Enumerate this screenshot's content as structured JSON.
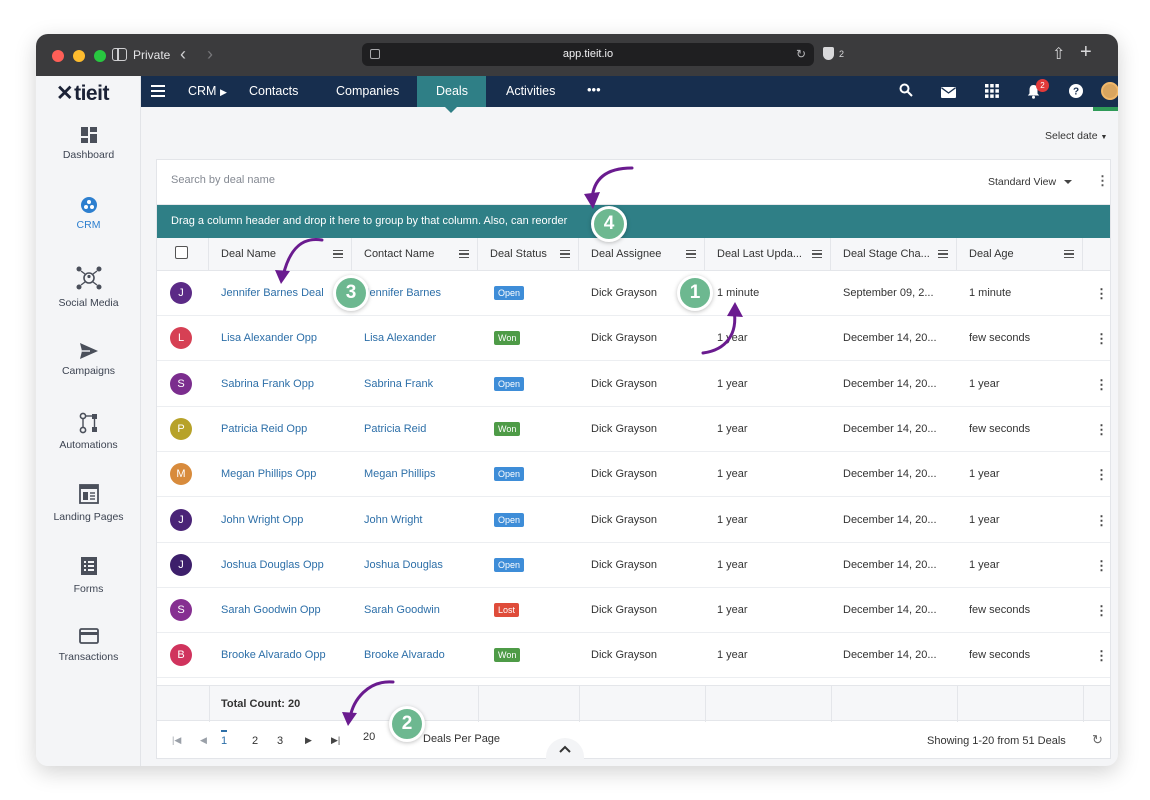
{
  "browser": {
    "private_label": "Private",
    "url": "app.tieit.io",
    "shield_count": "2"
  },
  "app": {
    "logo_text": "tieit",
    "sidebar": [
      {
        "label": "Dashboard",
        "icon": "dashboard-icon"
      },
      {
        "label": "CRM",
        "icon": "crm-icon",
        "active": true
      },
      {
        "label": "Social Media",
        "icon": "social-media-icon"
      },
      {
        "label": "Campaigns",
        "icon": "send-icon"
      },
      {
        "label": "Automations",
        "icon": "automation-icon"
      },
      {
        "label": "Landing Pages",
        "icon": "landing-page-icon"
      },
      {
        "label": "Forms",
        "icon": "form-icon"
      },
      {
        "label": "Transactions",
        "icon": "credit-card-icon"
      }
    ],
    "topnav": {
      "crm": "CRM",
      "contacts": "Contacts",
      "companies": "Companies",
      "deals": "Deals",
      "activities": "Activities",
      "more": "•••",
      "notification_count": "2"
    },
    "select_date": "Select date"
  },
  "grid": {
    "search_placeholder": "Search by deal name",
    "view": "Standard View",
    "group_hint": "Drag a column header and drop it here to group by that column. Also, can reorder",
    "columns": [
      "Deal Name",
      "Contact Name",
      "Deal Status",
      "Deal Assignee",
      "Deal Last Upda...",
      "Deal Stage Cha...",
      "Deal Age"
    ],
    "rows": [
      {
        "initial": "J",
        "color": "#5b2a86",
        "deal": "Jennifer Barnes Deal",
        "contact": "Jennifer Barnes",
        "status": "Open",
        "assignee": "Dick Grayson",
        "updated": "1 minute",
        "stage": "September 09, 2...",
        "age": "1 minute"
      },
      {
        "initial": "L",
        "color": "#d64054",
        "deal": "Lisa Alexander Opp",
        "contact": "Lisa Alexander",
        "status": "Won",
        "assignee": "Dick Grayson",
        "updated": "1 year",
        "stage": "December 14, 20...",
        "age": "few seconds"
      },
      {
        "initial": "S",
        "color": "#7b2d8e",
        "deal": "Sabrina Frank Opp",
        "contact": "Sabrina Frank",
        "status": "Open",
        "assignee": "Dick Grayson",
        "updated": "1 year",
        "stage": "December 14, 20...",
        "age": "1 year"
      },
      {
        "initial": "P",
        "color": "#b7a229",
        "deal": "Patricia Reid Opp",
        "contact": "Patricia Reid",
        "status": "Won",
        "assignee": "Dick Grayson",
        "updated": "1 year",
        "stage": "December 14, 20...",
        "age": "few seconds"
      },
      {
        "initial": "M",
        "color": "#d88b3c",
        "deal": "Megan Phillips Opp",
        "contact": "Megan Phillips",
        "status": "Open",
        "assignee": "Dick Grayson",
        "updated": "1 year",
        "stage": "December 14, 20...",
        "age": "1 year"
      },
      {
        "initial": "J",
        "color": "#4a2477",
        "deal": "John Wright Opp",
        "contact": "John Wright",
        "status": "Open",
        "assignee": "Dick Grayson",
        "updated": "1 year",
        "stage": "December 14, 20...",
        "age": "1 year"
      },
      {
        "initial": "J",
        "color": "#3d1f6b",
        "deal": "Joshua Douglas Opp",
        "contact": "Joshua Douglas",
        "status": "Open",
        "assignee": "Dick Grayson",
        "updated": "1 year",
        "stage": "December 14, 20...",
        "age": "1 year"
      },
      {
        "initial": "S",
        "color": "#862f91",
        "deal": "Sarah Goodwin Opp",
        "contact": "Sarah Goodwin",
        "status": "Lost",
        "assignee": "Dick Grayson",
        "updated": "1 year",
        "stage": "December 14, 20...",
        "age": "few seconds"
      },
      {
        "initial": "B",
        "color": "#d0335d",
        "deal": "Brooke Alvarado Opp",
        "contact": "Brooke Alvarado",
        "status": "Won",
        "assignee": "Dick Grayson",
        "updated": "1 year",
        "stage": "December 14, 20...",
        "age": "few seconds"
      }
    ],
    "total_count": "Total Count: 20",
    "pagination": {
      "pages": [
        "1",
        "2",
        "3"
      ],
      "current_page": "1",
      "page_size": "20",
      "per_page_label": "Deals Per Page",
      "showing": "Showing 1-20 from 51 Deals"
    }
  },
  "annotations": [
    "1",
    "2",
    "3",
    "4"
  ],
  "colors": {
    "topnav": "#172e4e",
    "accent_teal": "#2f7f86",
    "marker_green": "#6db890",
    "arrow_purple": "#6a1b8f",
    "link_blue": "#2d6fa8"
  }
}
